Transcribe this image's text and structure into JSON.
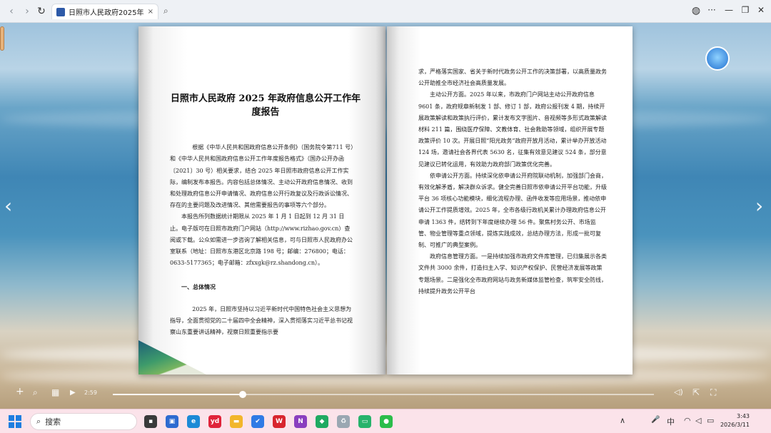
{
  "browser": {
    "tab_title": "日照市人民政府2025年政府信",
    "tab_close": "×",
    "back": "‹",
    "forward": "›",
    "reload": "↻",
    "search_tab": "⌕",
    "globe": "◍",
    "more": "···",
    "minimize": "—",
    "restore": "❐",
    "close": "✕"
  },
  "document": {
    "title": "日照市人民政府 2025 年政府信息公开工作年度报告",
    "left_page_text": "　　根据《中华人民共和国政府信息公开条例》（国务院令第711 号）和《中华人民共和国政府信息公开工作年度报告格式》（国办公开办函〔2021〕30 号）相关要求，结合 2025 年日照市政府信息公开工作实际，编制发布本报告。内容包括总体情况、主动公开政府信息情况、收到和处理政府信息公开申请情况、政府信息公开行政复议及行政诉讼情况、存在的主要问题及改进情况、其他需要报告的事项等六个部分。\n　　本报告所列数据统计期限从 2025 年 1 月 1 日起到 12 月 31 日止。电子版可在日照市政府门户网站（http://www.rizhao.gov.cn）查阅或下载。公众如需进一步咨询了解相关信息，可与日照市人民政府办公室联系（地址：日照市东港区北京路 198 号；邮编：276800；电话：0633-5177365；电子邮箱：zfxxgk@rz.shandong.cn）。",
    "left_heading": "　　一、总体情况",
    "left_page_text2": "　　2025 年，日照市坚持以习近平新时代中国特色社会主义思想为指导，全面贯彻党的二十届四中全会精神，深入贯彻落实习近平总书记视察山东重要讲话精神，视察日照重要指示要",
    "right_page_text": "求，严格落实国家、省关于新时代政务公开工作的决策部署，以高质量政务公开助推全市经济社会高质量发展。\n　　主动公开方面。2025 年以来，市政府门户网站主动公开政府信息 9601 条，政府规章新制发 1 部、修订 1 部，政府公报刊发 4 期，持续开展政策解读和政策执行评价，累计发布文字图片、音视频等多形式政策解读材料 211 篇，围绕医疗保障、文教体育、社会救助等领域，组织开展专题政策评价 10 次。开展日照“阳光政务”政府开放月活动，累计举办开放活动 124 场，邀请社会各界代表 5630 名，征集有效意见建议 524 条，部分意见建议已转化运用，有效助力政府部门政策优化完善。\n　　依申请公开方面。持续深化依申请公开府院联动机制，加强部门会商，有效化解矛盾，解决群众诉求。健全完善日照市依申请公开平台功能，升级平台 36 项核心功能模块，细化流程办理、函件收发等应用场景，推动依申请公开工作提质增效。2025 年，全市各级行政机关累计办理政府信息公开申请 1363 件，结转到下年度继续办理 56 件。聚焦村务公开、市场监管、物业管理等重点领域，提炼实践成效，总结办理方法，形成一批可复制、可推广的典型案例。\n　　政府信息管理方面。一是持续加强市政府文件库管理，已归集展示各类文件共 3000 余件，打造扫主入学、知识产权保护、民营经济发展等政策专题场景。二是强化全市政府网站与政务新媒体监管检查，筑牢安全防线，持续提升政务公开平台"
  },
  "player": {
    "zoom_in": "+",
    "zoom_search": "⌕",
    "grid": "▦",
    "play": "▶",
    "time": "2:59",
    "progress": 0.24,
    "volume": "◁)",
    "share": "⇱",
    "fullscreen": "⛶",
    "prev": "‹",
    "next": "›"
  },
  "taskbar": {
    "search_label": "搜索",
    "search_icon": "⌕",
    "apps": [
      {
        "name": "app-notepad",
        "glyph": "▪",
        "color": "#3a3a3a"
      },
      {
        "name": "app-panel",
        "glyph": "▣",
        "color": "#2d6bd0"
      },
      {
        "name": "app-edge",
        "glyph": "e",
        "color": "#1c8ad6"
      },
      {
        "name": "app-youdao",
        "glyph": "yd",
        "color": "#e0243a"
      },
      {
        "name": "app-files",
        "glyph": "▬",
        "color": "#f2b62b"
      },
      {
        "name": "app-todo",
        "glyph": "✔",
        "color": "#2f7be5"
      },
      {
        "name": "app-wps",
        "glyph": "W",
        "color": "#d8252e"
      },
      {
        "name": "app-onenote",
        "glyph": "N",
        "color": "#8a3fbf"
      },
      {
        "name": "app-chat",
        "glyph": "◆",
        "color": "#1faa62"
      },
      {
        "name": "app-recycle",
        "glyph": "♻",
        "color": "#9aa7b2"
      },
      {
        "name": "app-monitor",
        "glyph": "▭",
        "color": "#27b36b"
      },
      {
        "name": "app-wechat",
        "glyph": "●",
        "color": "#2bbd4a"
      }
    ],
    "tray_up": "∧",
    "tray_ime": "中",
    "tray_mic": "🎤",
    "tray_wifi": "◠",
    "tray_volume": "◁",
    "tray_battery": "▭",
    "time": "3:43",
    "date": "2026/3/11"
  }
}
